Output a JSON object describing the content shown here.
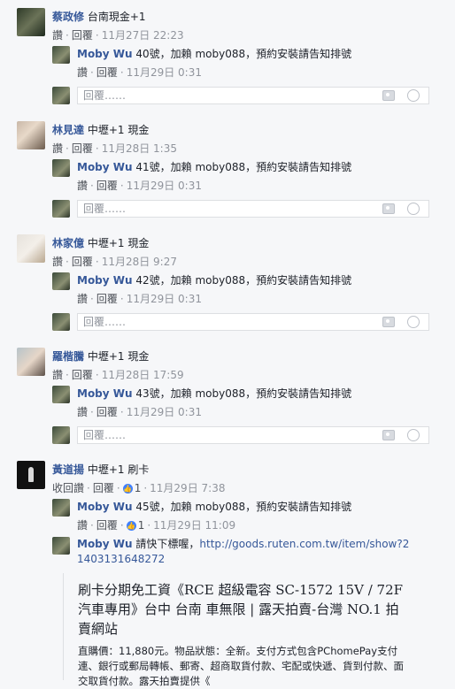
{
  "labels": {
    "like": "讚",
    "reply": "回覆",
    "unlike": "收回讚",
    "reply_placeholder": "回覆……"
  },
  "threads": [
    {
      "author": "蔡政修",
      "text": "台南現金+1",
      "time": "11月27日 22:23",
      "reply": {
        "author": "Moby Wu",
        "text": "40號，加賴 moby088，預約安裝請告知排號",
        "time": "11月29日 0:31"
      }
    },
    {
      "author": "林見達",
      "text": "中壢+1 現金",
      "time": "11月28日 1:35",
      "reply": {
        "author": "Moby Wu",
        "text": "41號，加賴 moby088，預約安裝請告知排號",
        "time": "11月29日 0:31"
      }
    },
    {
      "author": "林家億",
      "text": "中壢+1 現金",
      "time": "11月28日 9:27",
      "reply": {
        "author": "Moby Wu",
        "text": "42號，加賴 moby088，預約安裝請告知排號",
        "time": "11月29日 0:31"
      }
    },
    {
      "author": "羅楷騰",
      "text": "中壢+1 現金",
      "time": "11月28日 17:59",
      "reply": {
        "author": "Moby Wu",
        "text": "43號，加賴 moby088，預約安裝請告知排號",
        "time": "11月29日 0:31"
      }
    }
  ],
  "last": {
    "author": "黃道揚",
    "text": "中壢+1 刷卡",
    "likes": "1",
    "time": "11月29日 7:38",
    "reply1": {
      "author": "Moby Wu",
      "text": "45號，加賴 moby088，預約安裝請告知排號",
      "likes": "1",
      "time": "11月29日 11:09"
    },
    "reply2": {
      "author": "Moby Wu",
      "text": "請快下標喔，",
      "link": "http://goods.ruten.com.tw/item/show?21403131648272"
    },
    "preview_title": "刷卡分期免工資《RCE 超級電容 SC-1572 15V / 72F 汽車專用》台中 台南 車無限 | 露天拍賣-台灣 NO.1 拍賣網站",
    "preview_desc": "直購價：11,880元。物品狀態：全新。支付方式包含PChomePay支付連、銀行或郵局轉帳、郵寄、超商取貨付款、宅配或快遞、貨到付款、面交取貨付款。露天拍賣提供《"
  }
}
